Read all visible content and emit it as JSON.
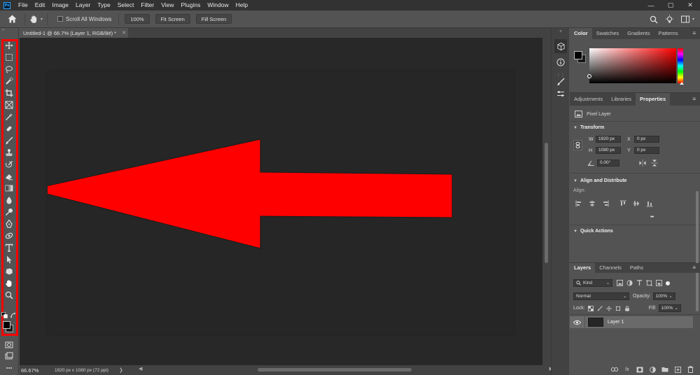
{
  "app": {
    "logo_text": "Ps",
    "accent_color": "#31a8ff"
  },
  "menu": [
    "File",
    "Edit",
    "Image",
    "Layer",
    "Type",
    "Select",
    "Filter",
    "View",
    "Plugins",
    "Window",
    "Help"
  ],
  "window_controls": {
    "minimize": "—",
    "maximize": "▢",
    "close": "✕"
  },
  "options": {
    "scroll_all_label": "Scroll All Windows",
    "zoom_100_label": "100%",
    "fit_screen_label": "Fit Screen",
    "fill_screen_label": "Fill Screen"
  },
  "document": {
    "tab_title": "Untitled-1 @ 66.7% (Layer 1, RGB/8#) *",
    "zoom": "66.67%",
    "info": "1920 px x 1080 px (72 ppi)",
    "arrow_color": "#ff0000"
  },
  "toolbar_highlight_color": "#ff0000",
  "tools": [
    "move-tool",
    "marquee-tool",
    "lasso-tool",
    "quick-select-tool",
    "crop-tool",
    "frame-tool",
    "eyedropper-tool",
    "healing-brush-tool",
    "brush-tool",
    "clone-stamp-tool",
    "history-brush-tool",
    "eraser-tool",
    "gradient-tool",
    "blur-tool",
    "dodge-tool",
    "pen-tool",
    "rotate-view-tool",
    "type-tool",
    "path-selection-tool",
    "rectangle-tool",
    "hand-tool",
    "zoom-tool"
  ],
  "color_panel": {
    "tabs": [
      "Color",
      "Swatches",
      "Gradients",
      "Patterns"
    ],
    "active_tab": "Color"
  },
  "properties_panel": {
    "tabs": [
      "Adjustments",
      "Libraries",
      "Properties"
    ],
    "active_tab": "Properties",
    "layer_kind": "Pixel Layer",
    "transform_title": "Transform",
    "w_label": "W",
    "w_value": "1920 px",
    "h_label": "H",
    "h_value": "1080 px",
    "x_label": "X",
    "x_value": "0 px",
    "y_label": "Y",
    "y_value": "0 px",
    "angle_value": "0.00°",
    "align_title": "Align and Distribute",
    "align_label": "Align:",
    "more": "•••",
    "quick_actions_title": "Quick Actions"
  },
  "layers_panel": {
    "tabs": [
      "Layers",
      "Channels",
      "Paths"
    ],
    "active_tab": "Layers",
    "kind_label": "Kind",
    "blend_mode": "Normal",
    "opacity_label": "Opacity:",
    "opacity_value": "100%",
    "lock_label": "Lock:",
    "fill_label": "Fill:",
    "fill_value": "100%",
    "layers": [
      {
        "name": "Layer 1",
        "visible": true
      }
    ],
    "footer_fx": "fx"
  }
}
